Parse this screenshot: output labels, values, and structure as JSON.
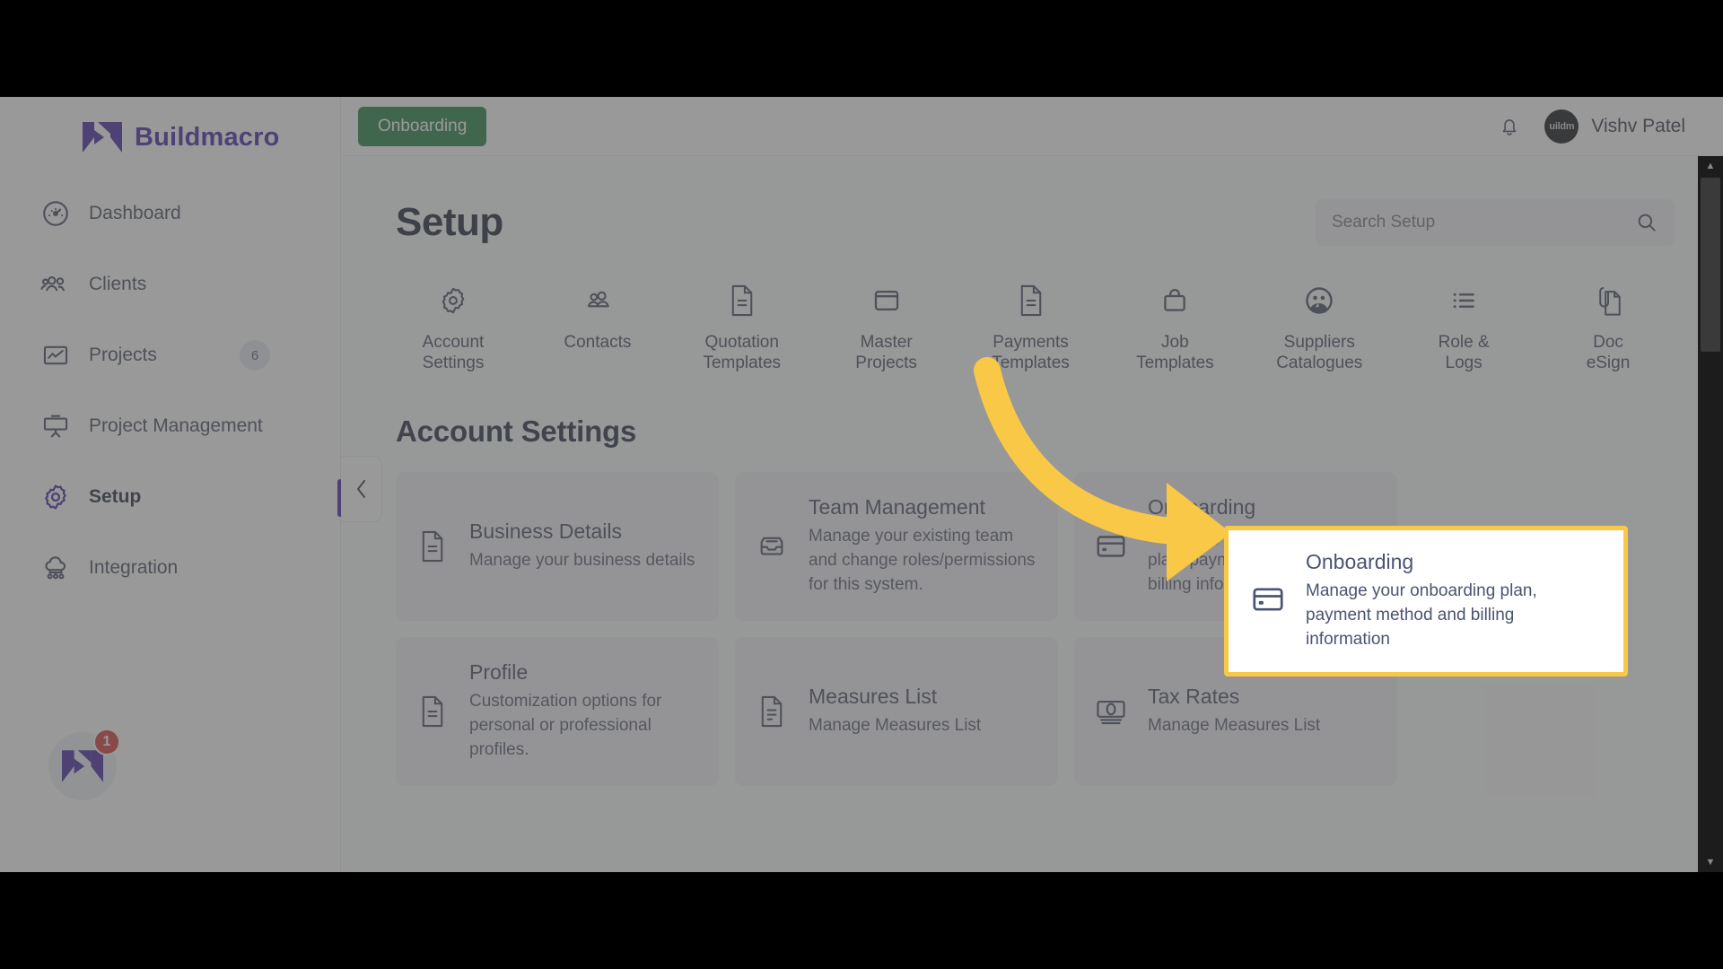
{
  "brand": {
    "name": "Buildmacro",
    "logo_icon": "buildmacro-logo-icon",
    "color": "#3b1a9e"
  },
  "sidebar": {
    "items": [
      {
        "label": "Dashboard",
        "icon": "gauge-icon",
        "badge": "",
        "active": false
      },
      {
        "label": "Clients",
        "icon": "users-group-icon",
        "badge": "",
        "active": false
      },
      {
        "label": "Projects",
        "icon": "chart-box-icon",
        "badge": "6",
        "active": false
      },
      {
        "label": "Project Management",
        "icon": "presentation-board-icon",
        "badge": "",
        "active": false
      },
      {
        "label": "Setup",
        "icon": "gear-icon",
        "badge": "",
        "active": true
      },
      {
        "label": "Integration",
        "icon": "cloud-network-icon",
        "badge": "",
        "active": false
      }
    ],
    "fab": {
      "icon": "buildmacro-logo-icon",
      "badge": "1",
      "badge_color": "#d32f2f"
    },
    "collapse_icon": "chevron-left-icon"
  },
  "topbar": {
    "onboarding_label": "Onboarding",
    "onboarding_color": "#1a7a3c",
    "bell_icon": "bell-icon",
    "avatar_text": "uildm",
    "user_name": "Vishv Patel"
  },
  "page": {
    "title": "Setup",
    "search": {
      "placeholder": "Search Setup",
      "value": "",
      "icon": "search-icon"
    }
  },
  "categories": [
    {
      "label": "Account\nSettings",
      "icon": "gear-icon"
    },
    {
      "label": "Contacts",
      "icon": "users-group-icon"
    },
    {
      "label": "Quotation\nTemplates",
      "icon": "document-lines-icon"
    },
    {
      "label": "Master\nProjects",
      "icon": "window-icon"
    },
    {
      "label": "Payments\nTemplates",
      "icon": "document-lines-icon"
    },
    {
      "label": "Job\nTemplates",
      "icon": "bag-icon"
    },
    {
      "label": "Suppliers\nCatalogues",
      "icon": "chat-people-icon"
    },
    {
      "label": "Role &\nLogs",
      "icon": "list-icon"
    },
    {
      "label": "Doc\neSign",
      "icon": "document-clip-icon"
    }
  ],
  "section": {
    "title": "Account Settings",
    "cards": [
      {
        "title": "Business Details",
        "desc": "Manage your business details",
        "icon": "document-lines-icon"
      },
      {
        "title": "Team Management",
        "desc": "Manage your existing team and change roles/permissions for this system.",
        "icon": "inbox-tray-icon"
      },
      {
        "title": "Onboarding",
        "desc": "Manage your onboarding plan, payment method and billing information",
        "icon": "credit-card-icon",
        "highlighted": true
      },
      {
        "title": "Profile",
        "desc": "Customization options for personal or professional profiles.",
        "icon": "document-lines-icon"
      },
      {
        "title": "Measures List",
        "desc": "Manage Measures List",
        "icon": "document-lines-icon"
      },
      {
        "title": "Tax Rates",
        "desc": "Manage Measures List",
        "icon": "banknote-icon"
      }
    ]
  },
  "annotation": {
    "arrow_color": "#f9c846",
    "highlight_border_color": "#f9c846",
    "target_card": "Onboarding"
  },
  "scrollbar": {
    "up_icon": "caret-up-icon",
    "down_icon": "caret-down-icon"
  }
}
